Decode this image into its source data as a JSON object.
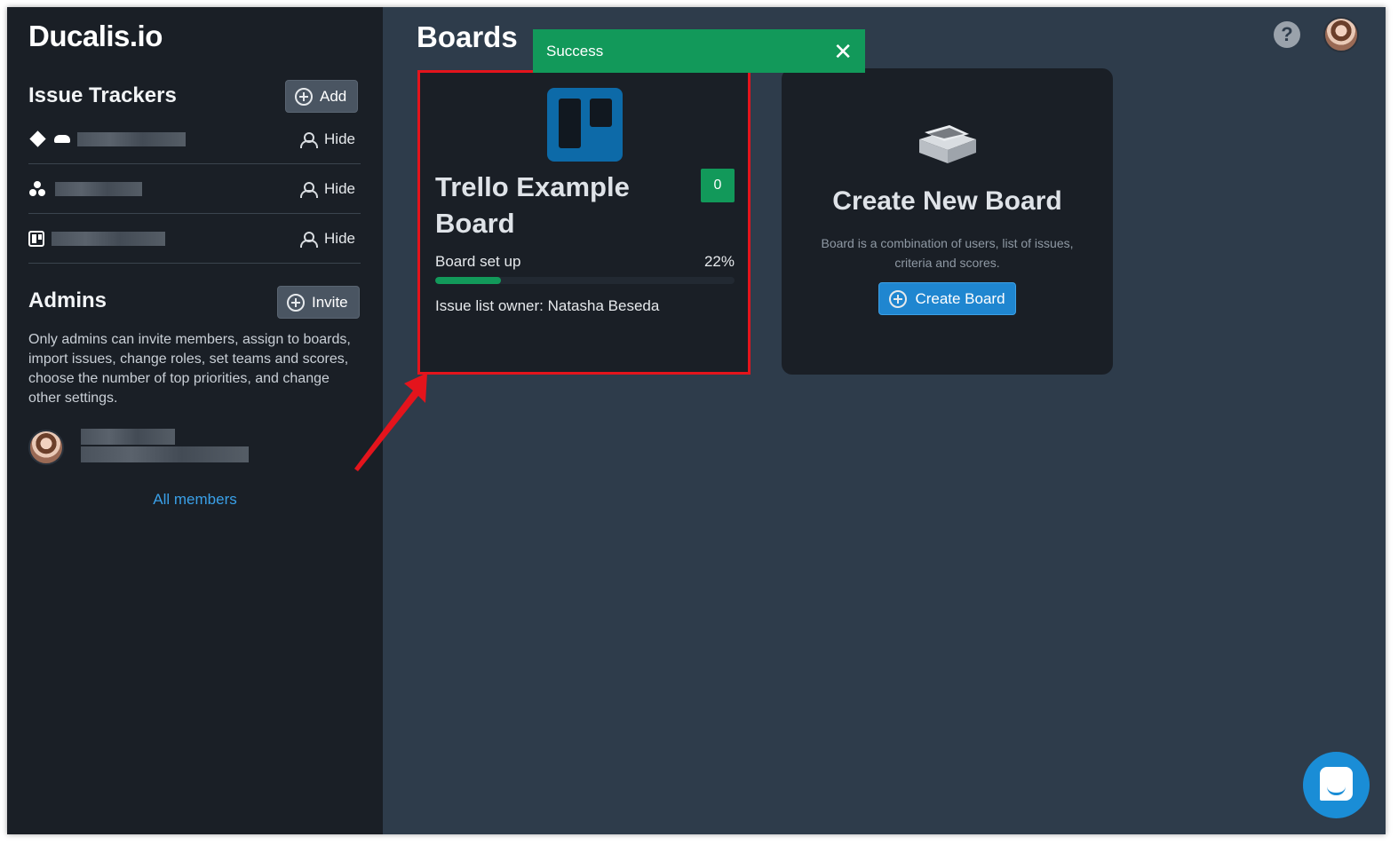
{
  "app": {
    "logo_text": "Ducalis.io"
  },
  "sidebar": {
    "issue_trackers": {
      "title": "Issue Trackers",
      "add_label": "Add",
      "rows": [
        {
          "icons": [
            "diamond-icon",
            "cloud-icon"
          ],
          "hide_label": "Hide"
        },
        {
          "icons": [
            "asana-dots-icon"
          ],
          "hide_label": "Hide"
        },
        {
          "icons": [
            "trello-icon"
          ],
          "hide_label": "Hide"
        }
      ]
    },
    "admins": {
      "title": "Admins",
      "invite_label": "Invite",
      "description": "Only admins can invite members, assign to boards, import issues, change roles, set teams and scores, choose the number of top priorities, and change other settings.",
      "all_members_label": "All members"
    }
  },
  "main": {
    "title": "Boards",
    "toast": {
      "message": "Success",
      "close_symbol": "✕"
    },
    "board": {
      "title": "Trello Example Board",
      "count": "0",
      "setup_label": "Board set up",
      "setup_percent_text": "22%",
      "setup_progress": 0.22,
      "owner_text": "Issue list owner: Natasha Beseda"
    },
    "new_board": {
      "title": "Create New Board",
      "description": "Board is a combination of users, list of issues, criteria and scores.",
      "button_label": "Create Board"
    }
  },
  "header": {
    "help_symbol": "?"
  },
  "colors": {
    "sidebar_bg": "#1a1f26",
    "main_bg": "#2e3c4b",
    "success": "#12995a",
    "primary": "#1f86d0",
    "highlight": "#e4141c",
    "trello": "#0d6aa8"
  }
}
